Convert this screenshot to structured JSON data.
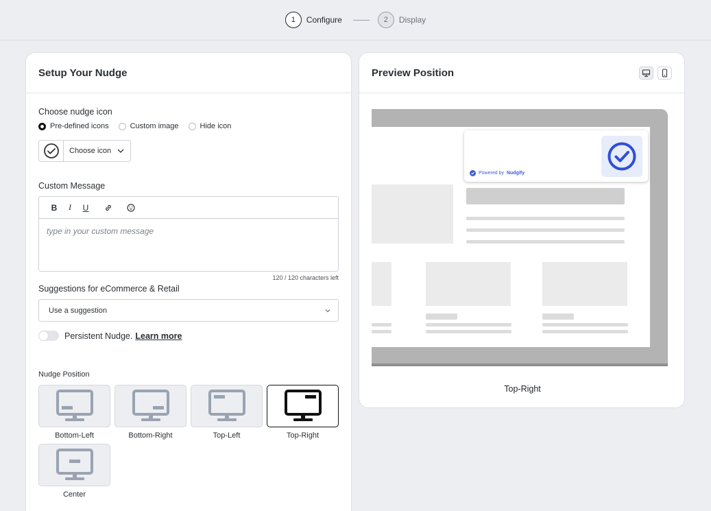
{
  "stepper": {
    "steps": [
      {
        "number": "1",
        "label": "Configure",
        "active": true
      },
      {
        "number": "2",
        "label": "Display",
        "active": false
      }
    ]
  },
  "setup": {
    "title": "Setup Your Nudge",
    "icon_section_label": "Choose nudge icon",
    "icon_options": [
      "Pre-defined icons",
      "Custom image",
      "Hide icon"
    ],
    "icon_selected": "Pre-defined icons",
    "choose_icon_label": "Choose icon",
    "message_label": "Custom Message",
    "message_placeholder": "type in your custom message",
    "char_counter": "120 / 120 characters left",
    "suggestions_label": "Suggestions for eCommerce & Retail",
    "suggestion_select": "Use a suggestion",
    "persistent_label": "Persistent Nudge.",
    "learn_more": "Learn more",
    "persistent_enabled": false,
    "position_label": "Nudge Position",
    "positions": [
      "Bottom-Left",
      "Bottom-Right",
      "Top-Left",
      "Top-Right",
      "Center"
    ],
    "position_selected": "Top-Right"
  },
  "preview": {
    "title": "Preview Position",
    "device_modes": [
      "desktop-icon",
      "mobile-icon"
    ],
    "device_selected": "desktop-icon",
    "powered_by_prefix": "Powered by",
    "powered_by_brand": "Nudgify",
    "position_caption": "Top-Right"
  },
  "colors": {
    "brand_blue": "#2f4fd6",
    "selected_border": "#111111",
    "muted_icon": "#9aa3b2"
  }
}
